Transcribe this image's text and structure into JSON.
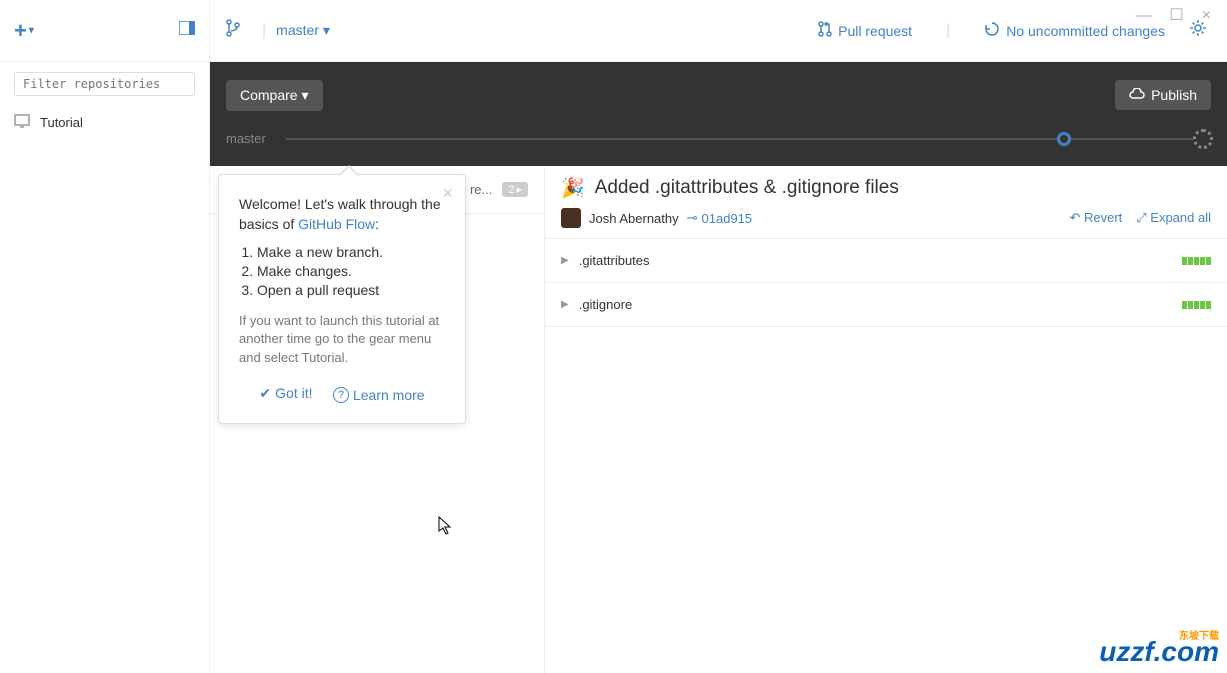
{
  "window": {
    "minimize": "—",
    "maximize": "☐",
    "close": "×"
  },
  "sidebar": {
    "filter_placeholder": "Filter repositories",
    "repo": "Tutorial"
  },
  "toolbar": {
    "branch": "master",
    "pull_request": "Pull request",
    "sync_status": "No uncommitted changes"
  },
  "darkbar": {
    "compare": "Compare",
    "publish": "Publish",
    "timeline_label": "master"
  },
  "commit_list": {
    "suffix": "re...",
    "badge": "2"
  },
  "popover": {
    "welcome_pre": "Welcome! Let's walk through the basics of ",
    "welcome_link": "GitHub Flow",
    "step1": "Make a new branch.",
    "step2": "Make changes.",
    "step3": "Open a pull request",
    "footnote": "If you want to launch this tutorial at another time go to the gear menu and select Tutorial.",
    "got_it": "Got it!",
    "learn_more": "Learn more"
  },
  "commit": {
    "title": "Added .gitattributes & .gitignore files",
    "author": "Josh Abernathy",
    "sha": "01ad915",
    "revert": "Revert",
    "expand": "Expand all",
    "files": [
      ".gitattributes",
      ".gitignore"
    ]
  },
  "watermark": {
    "tag": "东坡下载",
    "text": "uzzf.com"
  }
}
